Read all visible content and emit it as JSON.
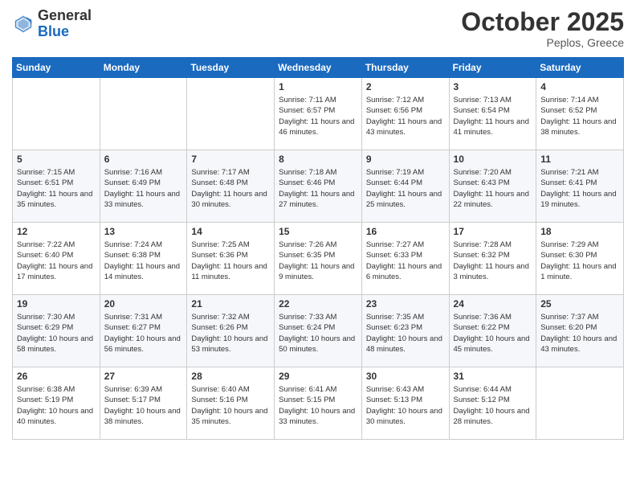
{
  "header": {
    "logo_line1": "General",
    "logo_line2": "Blue",
    "month": "October 2025",
    "location": "Peplos, Greece"
  },
  "weekdays": [
    "Sunday",
    "Monday",
    "Tuesday",
    "Wednesday",
    "Thursday",
    "Friday",
    "Saturday"
  ],
  "weeks": [
    [
      {
        "day": "",
        "info": ""
      },
      {
        "day": "",
        "info": ""
      },
      {
        "day": "",
        "info": ""
      },
      {
        "day": "1",
        "info": "Sunrise: 7:11 AM\nSunset: 6:57 PM\nDaylight: 11 hours and 46 minutes."
      },
      {
        "day": "2",
        "info": "Sunrise: 7:12 AM\nSunset: 6:56 PM\nDaylight: 11 hours and 43 minutes."
      },
      {
        "day": "3",
        "info": "Sunrise: 7:13 AM\nSunset: 6:54 PM\nDaylight: 11 hours and 41 minutes."
      },
      {
        "day": "4",
        "info": "Sunrise: 7:14 AM\nSunset: 6:52 PM\nDaylight: 11 hours and 38 minutes."
      }
    ],
    [
      {
        "day": "5",
        "info": "Sunrise: 7:15 AM\nSunset: 6:51 PM\nDaylight: 11 hours and 35 minutes."
      },
      {
        "day": "6",
        "info": "Sunrise: 7:16 AM\nSunset: 6:49 PM\nDaylight: 11 hours and 33 minutes."
      },
      {
        "day": "7",
        "info": "Sunrise: 7:17 AM\nSunset: 6:48 PM\nDaylight: 11 hours and 30 minutes."
      },
      {
        "day": "8",
        "info": "Sunrise: 7:18 AM\nSunset: 6:46 PM\nDaylight: 11 hours and 27 minutes."
      },
      {
        "day": "9",
        "info": "Sunrise: 7:19 AM\nSunset: 6:44 PM\nDaylight: 11 hours and 25 minutes."
      },
      {
        "day": "10",
        "info": "Sunrise: 7:20 AM\nSunset: 6:43 PM\nDaylight: 11 hours and 22 minutes."
      },
      {
        "day": "11",
        "info": "Sunrise: 7:21 AM\nSunset: 6:41 PM\nDaylight: 11 hours and 19 minutes."
      }
    ],
    [
      {
        "day": "12",
        "info": "Sunrise: 7:22 AM\nSunset: 6:40 PM\nDaylight: 11 hours and 17 minutes."
      },
      {
        "day": "13",
        "info": "Sunrise: 7:24 AM\nSunset: 6:38 PM\nDaylight: 11 hours and 14 minutes."
      },
      {
        "day": "14",
        "info": "Sunrise: 7:25 AM\nSunset: 6:36 PM\nDaylight: 11 hours and 11 minutes."
      },
      {
        "day": "15",
        "info": "Sunrise: 7:26 AM\nSunset: 6:35 PM\nDaylight: 11 hours and 9 minutes."
      },
      {
        "day": "16",
        "info": "Sunrise: 7:27 AM\nSunset: 6:33 PM\nDaylight: 11 hours and 6 minutes."
      },
      {
        "day": "17",
        "info": "Sunrise: 7:28 AM\nSunset: 6:32 PM\nDaylight: 11 hours and 3 minutes."
      },
      {
        "day": "18",
        "info": "Sunrise: 7:29 AM\nSunset: 6:30 PM\nDaylight: 11 hours and 1 minute."
      }
    ],
    [
      {
        "day": "19",
        "info": "Sunrise: 7:30 AM\nSunset: 6:29 PM\nDaylight: 10 hours and 58 minutes."
      },
      {
        "day": "20",
        "info": "Sunrise: 7:31 AM\nSunset: 6:27 PM\nDaylight: 10 hours and 56 minutes."
      },
      {
        "day": "21",
        "info": "Sunrise: 7:32 AM\nSunset: 6:26 PM\nDaylight: 10 hours and 53 minutes."
      },
      {
        "day": "22",
        "info": "Sunrise: 7:33 AM\nSunset: 6:24 PM\nDaylight: 10 hours and 50 minutes."
      },
      {
        "day": "23",
        "info": "Sunrise: 7:35 AM\nSunset: 6:23 PM\nDaylight: 10 hours and 48 minutes."
      },
      {
        "day": "24",
        "info": "Sunrise: 7:36 AM\nSunset: 6:22 PM\nDaylight: 10 hours and 45 minutes."
      },
      {
        "day": "25",
        "info": "Sunrise: 7:37 AM\nSunset: 6:20 PM\nDaylight: 10 hours and 43 minutes."
      }
    ],
    [
      {
        "day": "26",
        "info": "Sunrise: 6:38 AM\nSunset: 5:19 PM\nDaylight: 10 hours and 40 minutes."
      },
      {
        "day": "27",
        "info": "Sunrise: 6:39 AM\nSunset: 5:17 PM\nDaylight: 10 hours and 38 minutes."
      },
      {
        "day": "28",
        "info": "Sunrise: 6:40 AM\nSunset: 5:16 PM\nDaylight: 10 hours and 35 minutes."
      },
      {
        "day": "29",
        "info": "Sunrise: 6:41 AM\nSunset: 5:15 PM\nDaylight: 10 hours and 33 minutes."
      },
      {
        "day": "30",
        "info": "Sunrise: 6:43 AM\nSunset: 5:13 PM\nDaylight: 10 hours and 30 minutes."
      },
      {
        "day": "31",
        "info": "Sunrise: 6:44 AM\nSunset: 5:12 PM\nDaylight: 10 hours and 28 minutes."
      },
      {
        "day": "",
        "info": ""
      }
    ]
  ]
}
